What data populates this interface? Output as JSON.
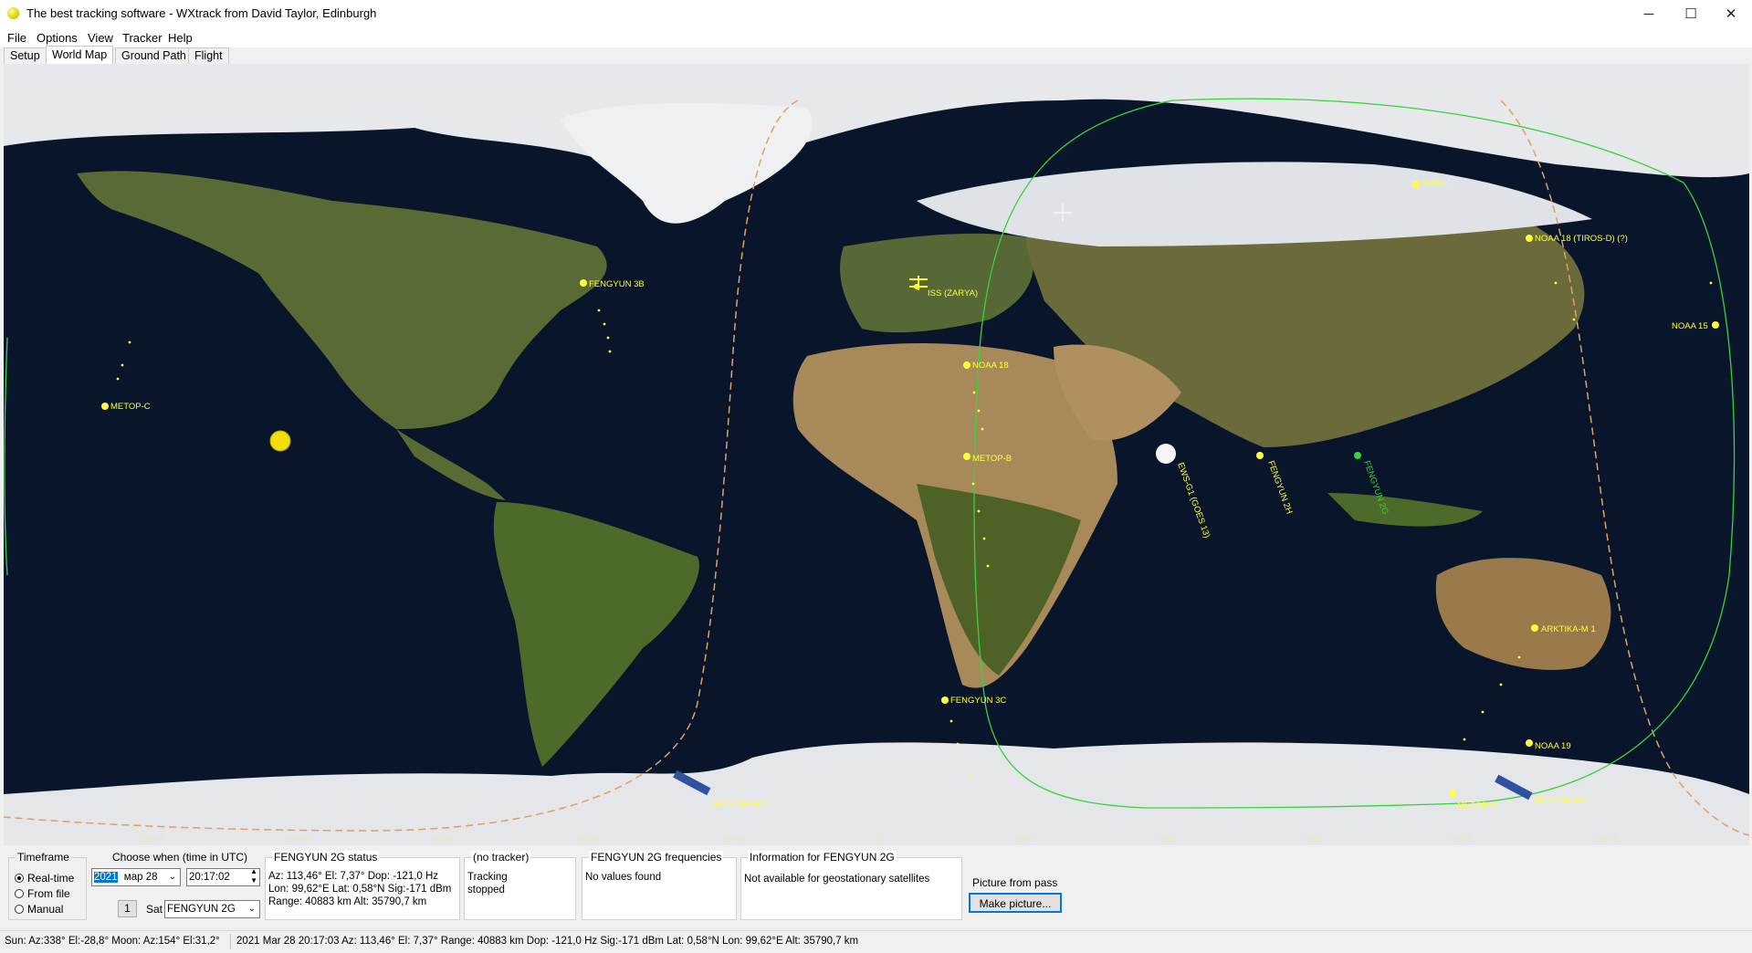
{
  "window": {
    "title": "The best tracking software - WXtrack from David Taylor, Edinburgh",
    "controls": {
      "minimize": "─",
      "maximize": "☐",
      "close": "✕"
    }
  },
  "menu": [
    "File",
    "Options",
    "View",
    "Tracker",
    "Help"
  ],
  "tabs": [
    {
      "label": "Setup",
      "active": false
    },
    {
      "label": "World Map",
      "active": true
    },
    {
      "label": "Ground Path",
      "active": false
    },
    {
      "label": "Flight",
      "active": false
    }
  ],
  "map": {
    "longitude_labels": [
      "150°W",
      "120°W",
      "90°W",
      "60°W",
      "30°W",
      "0°",
      "30°E",
      "60°E",
      "90°E",
      "120°E",
      "150°E"
    ],
    "satellites": [
      "FENGYUN 3B",
      "ISS (ZARYA)",
      "YARAL",
      "NOAA 18 (TIROS-D) (?)",
      "NOAA 15",
      "METOP-C",
      "NOAA 18",
      "METOP-B",
      "EWS-G1 (GOES 13)",
      "FENGYUN 2H",
      "FENGYUN 2G",
      "ARKTIKA-M 1",
      "FENGYUN 3C",
      "METEOR-M2 2",
      "METOP-A",
      "METEOR-M 2",
      "NOAA 19"
    ],
    "colors": {
      "ocean": "#09152b",
      "land": "#5a6a34",
      "desert": "#a88a5a",
      "ice": "#e8eaee",
      "track": "#3ad23a",
      "terminator": "#e0a060",
      "satellite": "#ffff3a"
    }
  },
  "timeframe": {
    "title": "Timeframe",
    "options": [
      {
        "label": "Real-time",
        "selected": true
      },
      {
        "label": "From file",
        "selected": false
      },
      {
        "label": "Manual",
        "selected": false
      }
    ]
  },
  "when": {
    "title": "Choose when (time in UTC)",
    "year": "2021",
    "date": "мар 28",
    "time": "20:17:02",
    "step": "1",
    "sat_label": "Sat",
    "sat_value": "FENGYUN 2G"
  },
  "status_box": {
    "title": "FENGYUN 2G status",
    "line1": "Az: 113,46°  El: 7,37°  Dop: -121,0 Hz",
    "line2": "Lon: 99,62°E  Lat: 0,58°N  Sig:-171 dBm",
    "line3": "Range: 40883 km  Alt: 35790,7 km"
  },
  "tracker": {
    "title": "(no tracker)",
    "line1": "Tracking",
    "line2": "stopped"
  },
  "frequencies": {
    "title": "FENGYUN 2G frequencies",
    "line1": "No values found"
  },
  "info": {
    "title": "Information for FENGYUN 2G",
    "line1": "Not available for geostationary satellites"
  },
  "picture": {
    "label": "Picture from pass",
    "button": "Make picture..."
  },
  "statusbar": {
    "left": "Sun: Az:338° El:-28,8°  Moon: Az:154° El:31,2°",
    "right": "2021 Mar 28  20:17:03  Az: 113,46°  El: 7,37°  Range: 40883 km  Dop: -121,0 Hz Sig:-171 dBm Lat: 0,58°N  Lon: 99,62°E  Alt: 35790,7 km"
  }
}
